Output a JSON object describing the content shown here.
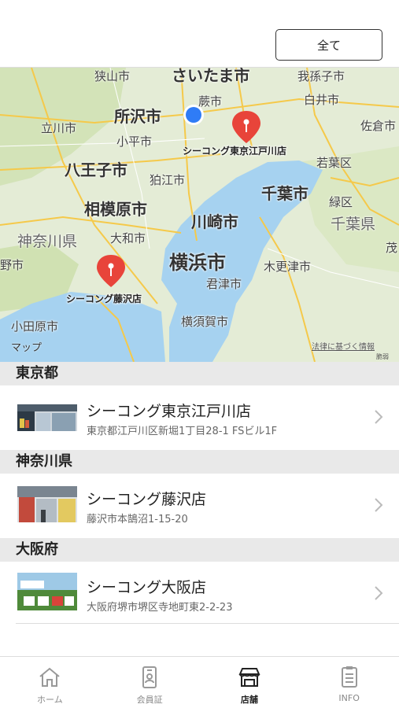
{
  "header": {
    "filter_label": "全て"
  },
  "map": {
    "labels": {
      "sayama": "狭山市",
      "saitama": "さいたま市",
      "abiko": "我孫子市",
      "warabi": "蕨市",
      "tokorozawa": "所沢市",
      "shiraoi": "白井市",
      "tachikawa": "立川市",
      "kodaira": "小平市",
      "sakura": "佐倉市",
      "hachioji": "八王子市",
      "komae": "狛江市",
      "wakaba": "若葉区",
      "chiba": "千葉市",
      "sagamihara": "相模原市",
      "kawasaki": "川崎市",
      "midori": "緑区",
      "chiba_pref": "千葉県",
      "kanagawa": "神奈川県",
      "yamato": "大和市",
      "yokohama": "横浜市",
      "mo": "茂",
      "kisarazu": "木更津市",
      "hino": "野市",
      "kimitsu": "君津市",
      "odawara": "小田原市",
      "yokosuka": "横須賀市"
    },
    "pins": [
      {
        "name": "シーコング東京江戸川店"
      },
      {
        "name": "シーコング藤沢店"
      }
    ],
    "attribution": "マップ",
    "legal": "法律に基づく情報",
    "legal_sub": "脆弱"
  },
  "sections": [
    {
      "title": "東京都",
      "store": {
        "name": "シーコング東京江戸川店",
        "address": "東京都江戸川区新堀1丁目28-1 FSビル1F"
      }
    },
    {
      "title": "神奈川県",
      "store": {
        "name": "シーコング藤沢店",
        "address": "藤沢市本鵠沼1-15-20"
      }
    },
    {
      "title": "大阪府",
      "store": {
        "name": "シーコング大阪店",
        "address": "大阪府堺市堺区寺地町東2-2-23"
      }
    }
  ],
  "tabs": [
    {
      "label": "ホーム",
      "icon": "home-icon"
    },
    {
      "label": "会員証",
      "icon": "member-card-icon"
    },
    {
      "label": "店舗",
      "icon": "store-icon"
    },
    {
      "label": "INFO",
      "icon": "info-list-icon"
    }
  ],
  "colors": {
    "pin": "#e8443a",
    "user_location": "#2f7cf6",
    "water": "#a6d2f0",
    "land": "#e4ecd6"
  }
}
